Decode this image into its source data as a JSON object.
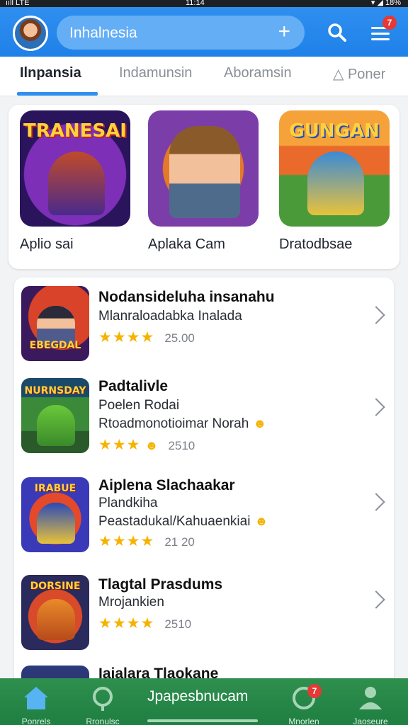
{
  "status_bar": {
    "left": "ııll LTE",
    "center": "11:14",
    "right": "▾ ◢ 18%"
  },
  "header": {
    "search": {
      "text": "Inhalnesia",
      "add_symbol": "+"
    },
    "menu_badge": "7"
  },
  "tabs": [
    {
      "label": "Ilnpansia",
      "active": true
    },
    {
      "label": "Indamunsin",
      "active": false
    },
    {
      "label": "Aboramsin",
      "active": false
    },
    {
      "label": "Poner",
      "active": false
    }
  ],
  "featured": [
    {
      "label": "Aplio sai",
      "art_text": "TRANESAI"
    },
    {
      "label": "Aplaka Cam",
      "art_text": ""
    },
    {
      "label": "Dratodbsae",
      "art_text": "GUNGAN"
    }
  ],
  "list": [
    {
      "title": "Nodansideluha insanahu",
      "subtitle": "Mlanraloadabka Inalada",
      "subtitle2": "",
      "stars": "★★★★",
      "rating": "25.00",
      "art_text": "EBEGDAL"
    },
    {
      "title": "Padtalivle",
      "subtitle": "Poelen Rodai",
      "subtitle2": "Rtoadmonotioimar Norah",
      "stars": "★★★",
      "rating": "2510",
      "art_text": "NURNSDAY"
    },
    {
      "title": "Aiplena Slachaakar",
      "subtitle": "Plandkiha",
      "subtitle2": "Peastadukal/Kahuaenkiai",
      "stars": "★★★★",
      "rating": "21 20",
      "art_text": "IRABUE"
    },
    {
      "title": "Tlagtal Prasdums",
      "subtitle": "Mrojankien",
      "subtitle2": "",
      "stars": "★★★★",
      "rating": "2510",
      "art_text": "DORSINE"
    },
    {
      "title": "Iaialara Tlaokane",
      "subtitle": "",
      "subtitle2": "",
      "stars": "",
      "rating": "",
      "art_text": ""
    }
  ],
  "bottom_nav": {
    "home_label": "Ponrels",
    "discover_label": "Rronulsc",
    "center_label": "Jpapesbnucam",
    "updates_label": "Mnorlen",
    "updates_badge": "7",
    "profile_label": "Jaoseure"
  },
  "colors": {
    "primary": "#2f8ff0",
    "nav_green": "#1f7f42",
    "star": "#f5b301",
    "badge": "#e53935"
  }
}
